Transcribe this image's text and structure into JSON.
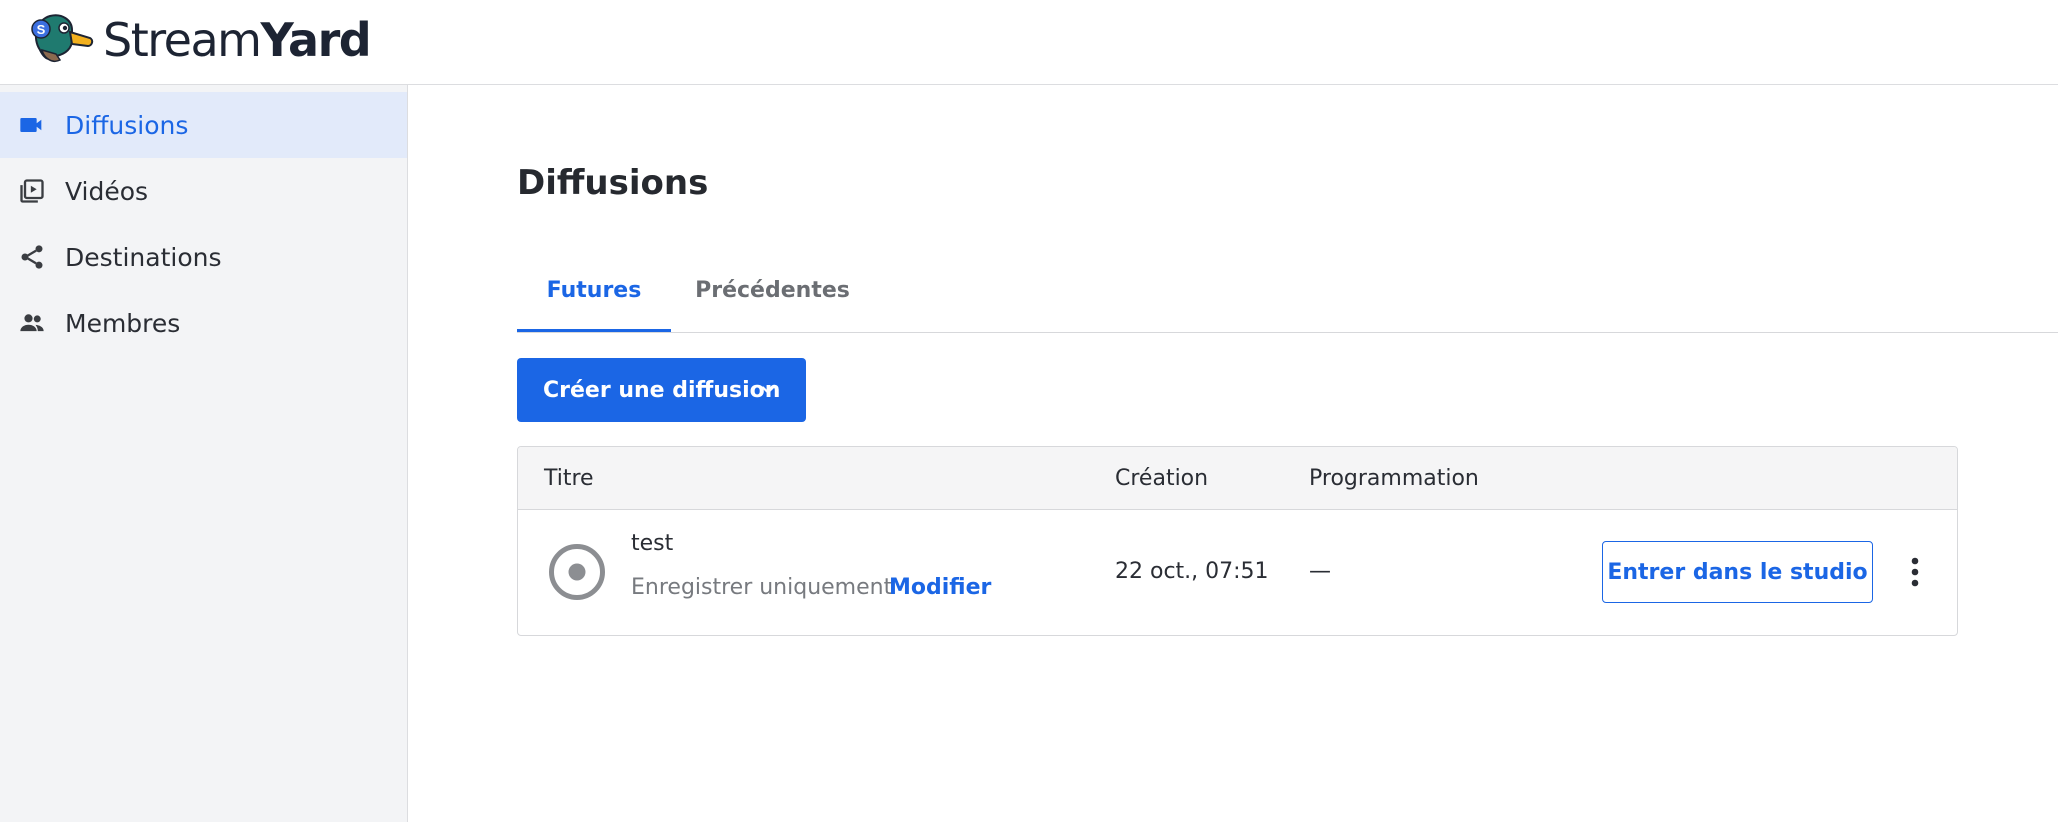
{
  "brand": {
    "logo_name_light": "Stream",
    "logo_name_bold": "Yard",
    "logo_badge": "S"
  },
  "sidebar": {
    "items": [
      {
        "label": "Diffusions",
        "icon": "video-camera-icon",
        "active": true
      },
      {
        "label": "Vidéos",
        "icon": "video-library-icon",
        "active": false
      },
      {
        "label": "Destinations",
        "icon": "share-icon",
        "active": false
      },
      {
        "label": "Membres",
        "icon": "people-icon",
        "active": false
      }
    ]
  },
  "main": {
    "title": "Diffusions",
    "tabs": [
      {
        "label": "Futures",
        "active": true
      },
      {
        "label": "Précédentes",
        "active": false
      }
    ],
    "create_button": {
      "label": "Créer une diffusion",
      "icon": "chevron-down-icon"
    },
    "table": {
      "headers": {
        "title": "Titre",
        "created": "Création",
        "scheduled": "Programmation"
      },
      "rows": [
        {
          "icon": "record-icon",
          "title": "test",
          "subtitle": "Enregistrer uniquement",
          "edit_label": "Modifier",
          "created": "22 oct., 07:51",
          "scheduled": "—",
          "enter_label": "Entrer dans le studio",
          "more_icon": "more-vertical-icon"
        }
      ]
    }
  },
  "colors": {
    "accent": "#1b66e5",
    "sidebar_bg": "#f3f4f6",
    "active_bg": "#e2eafa",
    "text": "#2a2d34",
    "muted": "#777a7f"
  }
}
